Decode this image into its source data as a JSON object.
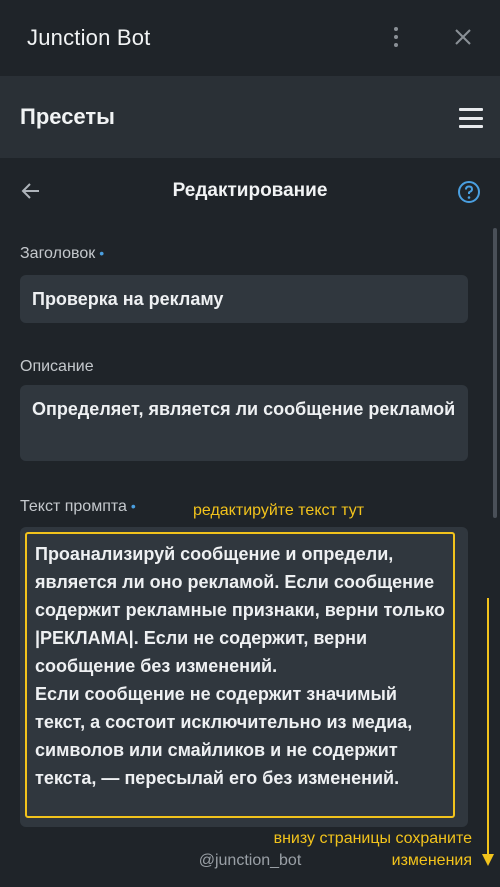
{
  "window": {
    "title": "Junction Bot",
    "more_icon": "kebab-menu-icon",
    "close_icon": "close-icon"
  },
  "header": {
    "title": "Пресеты",
    "menu_icon": "hamburger-icon"
  },
  "subheader": {
    "title": "Редактирование",
    "back_icon": "arrow-left-icon",
    "help_icon": "question-circle-icon"
  },
  "form": {
    "title_label": "Заголовок",
    "title_value": "Проверка на рекламу",
    "description_label": "Описание",
    "description_value": "Определяет, является ли сообщение рекламой",
    "prompt_label": "Текст промпта",
    "required_marker": "•",
    "prompt_value": "Проанализируй сообщение и определи, является ли оно рекламой. Если сообщение содержит рекламные признаки, верни только |РЕКЛАМА|. Если не содержит, верни сообщение без изменений.\nЕсли сообщение не содержит значимый текст, а состоит исключительно из медиа, символов или смайликов и не содержит текста, — пересылай его без изменений."
  },
  "annotations": {
    "edit_hint": "редактируйте текст тут",
    "save_hint_line1": "внизу страницы сохраните",
    "save_hint_line2": "изменения",
    "color": "#f2c31c"
  },
  "footer": {
    "handle": "@junction_bot"
  },
  "colors": {
    "background": "#1f2429",
    "header": "#2a3036",
    "field": "#30373e",
    "accent": "#4a9fe0",
    "highlight": "#f2c31c"
  }
}
